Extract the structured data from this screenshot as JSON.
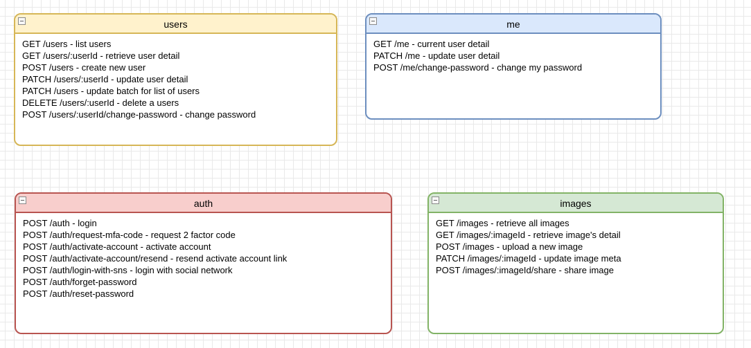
{
  "panels": {
    "users": {
      "title": "users",
      "lines": "GET /users - list users\nGET /users/:userId - retrieve user detail\nPOST /users - create new user\nPATCH /users/:userId - update user detail\nPATCH /users - update batch for list of users\nDELETE /users/:userId - delete a users\nPOST /users/:userId/change-password - change password"
    },
    "me": {
      "title": "me",
      "lines": "GET /me - current user detail\nPATCH /me - update user detail\nPOST /me/change-password - change my password"
    },
    "auth": {
      "title": "auth",
      "lines": "POST /auth - login\nPOST /auth/request-mfa-code - request 2 factor code\nPOST /auth/activate-account - activate account\nPOST /auth/activate-account/resend - resend activate account link\nPOST /auth/login-with-sns - login with social network\nPOST /auth/forget-password\nPOST /auth/reset-password"
    },
    "images": {
      "title": "images",
      "lines": "GET /images - retrieve all images\nGET /images/:imageId - retrieve image's detail\nPOST /images - upload a new image\nPATCH /images/:imageId - update image meta\nPOST /images/:imageId/share - share image"
    }
  }
}
